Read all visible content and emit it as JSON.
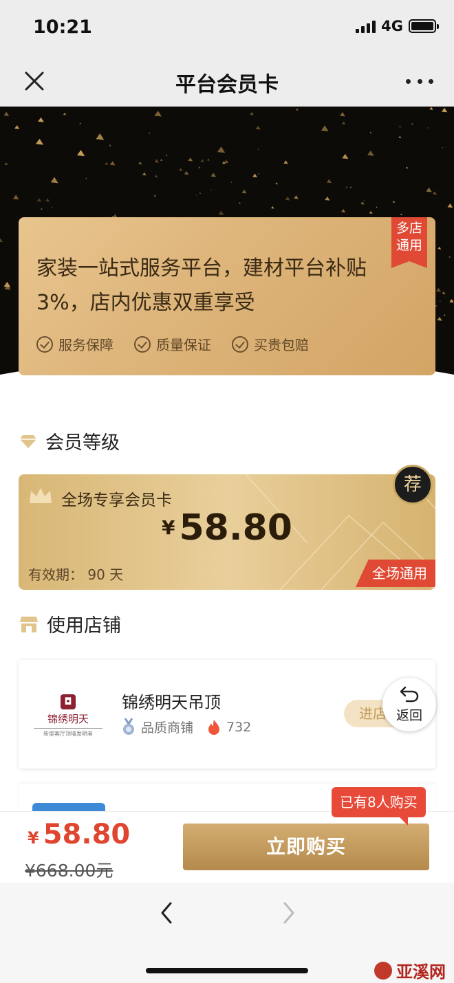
{
  "status_bar": {
    "time": "10:21",
    "network": "4G"
  },
  "nav": {
    "title": "平台会员卡"
  },
  "promo": {
    "ribbon_line1": "多店",
    "ribbon_line2": "通用",
    "headline_line1": "家装一站式服务平台，建材平台补贴",
    "headline_line2": "3%，店内优惠双重享受",
    "features": [
      "服务保障",
      "质量保证",
      "买贵包赔"
    ]
  },
  "member_level": {
    "section_title": "会员等级",
    "card_name": "全场专享会员卡",
    "currency": "¥",
    "price": "58.80",
    "validity": "有效期：  90 天",
    "tag": "全场通用",
    "badge": "荐"
  },
  "stores": {
    "section_title": "使用店铺",
    "items": [
      {
        "logo_text": "锦绣明天",
        "logo_slogan": "新型客厅顶墙发明者",
        "name": "锦绣明天吊顶",
        "badge": "品质商铺",
        "hot_count": "732",
        "enter_label": "进店"
      }
    ]
  },
  "back_button": {
    "label": "返回"
  },
  "buy_bar": {
    "currency": "¥",
    "current_price": "58.80",
    "original_price": "¥668.00元",
    "buy_label": "立即购买",
    "bought_tip": "已有8人购买"
  },
  "watermark": {
    "text": "亚溪网"
  },
  "colors": {
    "accent_red": "#e0462f",
    "gold": "#d3ad71",
    "dark": "#0d0b08"
  },
  "icons": [
    "close-icon",
    "more-icon",
    "check-circle-icon",
    "diamond-icon",
    "crown-icon",
    "store-icon",
    "medal-icon",
    "fire-icon",
    "back-arrow-icon",
    "chevron-left-icon",
    "chevron-right-icon"
  ]
}
